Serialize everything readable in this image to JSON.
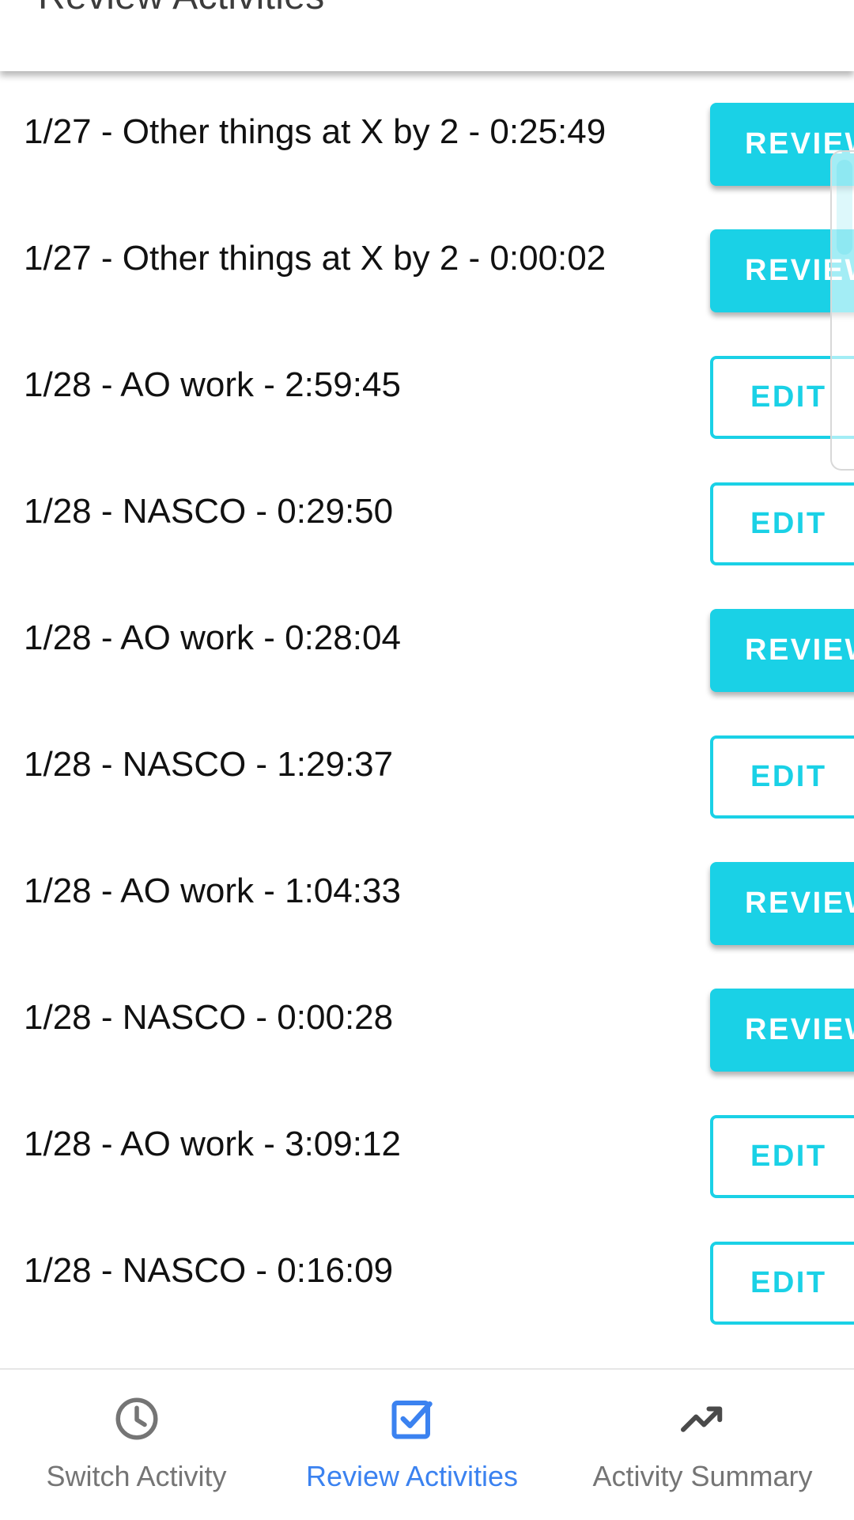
{
  "app_bar": {
    "title": "Review Activities"
  },
  "colors": {
    "accent": "#1ad1e6",
    "active_nav": "#3b82f0",
    "inactive_nav": "#757575",
    "text": "#111111"
  },
  "activities": [
    {
      "label": "1/27 - Other things at X by 2 - 0:25:49",
      "action": "REVIEW",
      "style": "review"
    },
    {
      "label": "1/27 - Other things at X by 2 - 0:00:02",
      "action": "REVIEW",
      "style": "review"
    },
    {
      "label": "1/28 - AO work - 2:59:45",
      "action": "EDIT",
      "style": "edit"
    },
    {
      "label": "1/28 - NASCO - 0:29:50",
      "action": "EDIT",
      "style": "edit"
    },
    {
      "label": "1/28 - AO work - 0:28:04",
      "action": "REVIEW",
      "style": "review"
    },
    {
      "label": "1/28 - NASCO - 1:29:37",
      "action": "EDIT",
      "style": "edit"
    },
    {
      "label": "1/28 - AO work - 1:04:33",
      "action": "REVIEW",
      "style": "review"
    },
    {
      "label": "1/28 - NASCO - 0:00:28",
      "action": "REVIEW",
      "style": "review"
    },
    {
      "label": "1/28 - AO work - 3:09:12",
      "action": "EDIT",
      "style": "edit"
    },
    {
      "label": "1/28 - NASCO - 0:16:09",
      "action": "EDIT",
      "style": "edit"
    }
  ],
  "bottom_nav": {
    "items": [
      {
        "label": "Switch Activity",
        "icon": "clock-icon",
        "active": false
      },
      {
        "label": "Review Activities",
        "icon": "checkbox-icon",
        "active": true
      },
      {
        "label": "Activity Summary",
        "icon": "trending-up-icon",
        "active": false
      }
    ]
  }
}
